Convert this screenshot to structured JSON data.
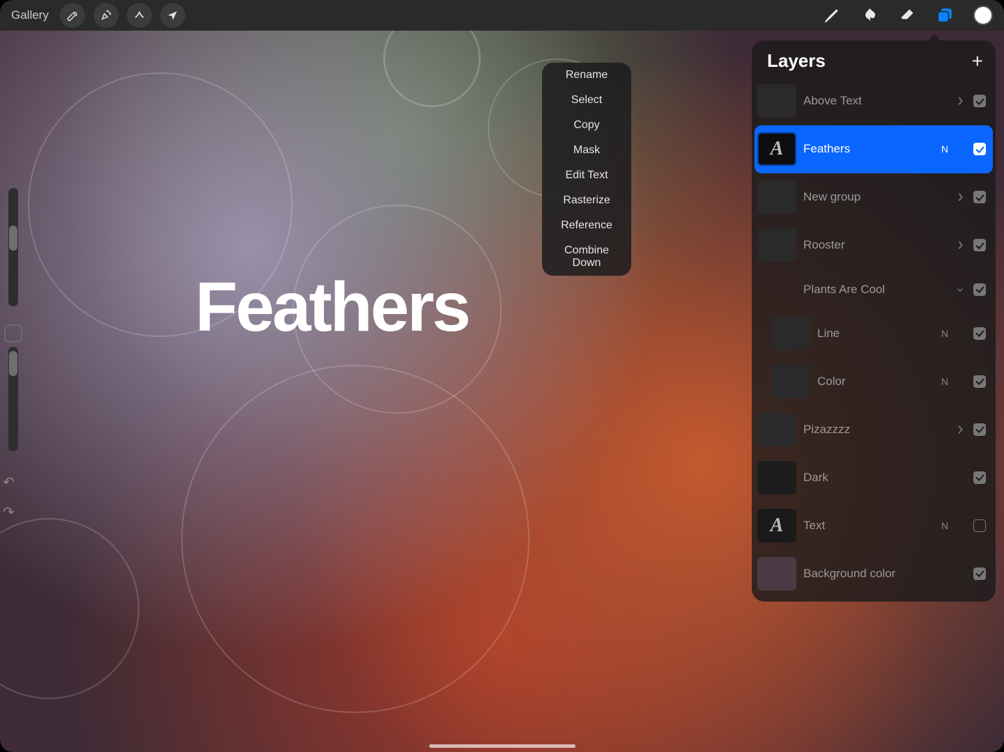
{
  "topbar": {
    "gallery_label": "Gallery"
  },
  "canvas": {
    "text_overlay": "Feathers"
  },
  "context_menu": {
    "items": [
      "Rename",
      "Select",
      "Copy",
      "Mask",
      "Edit Text",
      "Rasterize",
      "Reference",
      "Combine Down"
    ]
  },
  "layers_panel": {
    "title": "Layers",
    "rows": [
      {
        "name": "Above Text",
        "blend": "",
        "chevron": "right",
        "visible": true,
        "thumb": "group",
        "indent": false,
        "selected": false,
        "text_glyph": false
      },
      {
        "name": "Feathers",
        "blend": "N",
        "chevron": "",
        "visible": true,
        "thumb": "A",
        "indent": false,
        "selected": true,
        "text_glyph": true
      },
      {
        "name": "New group",
        "blend": "",
        "chevron": "right",
        "visible": true,
        "thumb": "group",
        "indent": false,
        "selected": false,
        "text_glyph": false
      },
      {
        "name": "Rooster",
        "blend": "",
        "chevron": "right",
        "visible": true,
        "thumb": "group",
        "indent": false,
        "selected": false,
        "text_glyph": false
      },
      {
        "name": "Plants Are Cool",
        "blend": "",
        "chevron": "down",
        "visible": true,
        "thumb": "none",
        "indent": false,
        "selected": false,
        "text_glyph": false
      },
      {
        "name": "Line",
        "blend": "N",
        "chevron": "",
        "visible": true,
        "thumb": "img",
        "indent": true,
        "selected": false,
        "text_glyph": false
      },
      {
        "name": "Color",
        "blend": "N",
        "chevron": "",
        "visible": true,
        "thumb": "img",
        "indent": true,
        "selected": false,
        "text_glyph": false
      },
      {
        "name": "Pizazzzz",
        "blend": "",
        "chevron": "right",
        "visible": true,
        "thumb": "group",
        "indent": false,
        "selected": false,
        "text_glyph": false
      },
      {
        "name": "Dark",
        "blend": "",
        "chevron": "",
        "visible": true,
        "thumb": "dark",
        "indent": false,
        "selected": false,
        "text_glyph": false
      },
      {
        "name": "Text",
        "blend": "N",
        "chevron": "",
        "visible": false,
        "thumb": "A",
        "indent": false,
        "selected": false,
        "text_glyph": true
      },
      {
        "name": "Background color",
        "blend": "",
        "chevron": "",
        "visible": true,
        "thumb": "bgcolor",
        "indent": false,
        "selected": false,
        "text_glyph": false
      }
    ]
  }
}
